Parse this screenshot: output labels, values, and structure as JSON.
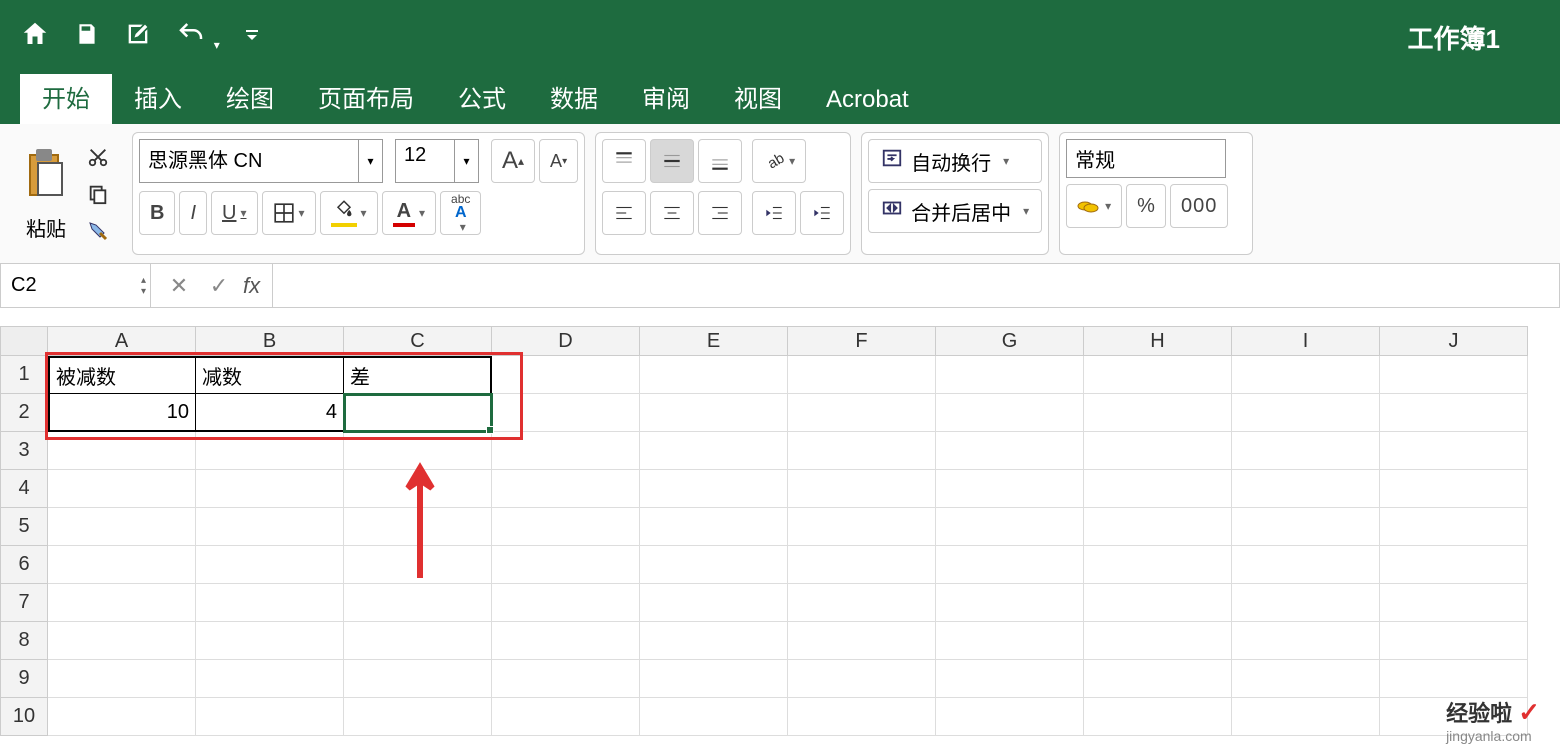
{
  "titlebar": {
    "doc_title": "工作簿1"
  },
  "tabs": {
    "home": "开始",
    "insert": "插入",
    "draw": "绘图",
    "layout": "页面布局",
    "formula": "公式",
    "data": "数据",
    "review": "审阅",
    "view": "视图",
    "acrobat": "Acrobat"
  },
  "ribbon": {
    "paste_label": "粘贴",
    "font_name": "思源黑体 CN",
    "font_size": "12",
    "wrap_text": "自动换行",
    "merge_center": "合并后居中",
    "number_format": "常规",
    "btn_bold": "B",
    "btn_italic": "I",
    "btn_underline": "U",
    "font_A_big": "A",
    "font_A_small": "A",
    "fill_icon": "◇",
    "font_color": "A",
    "phonetic": "abc",
    "phonetic_sub": "A",
    "thousand": "000",
    "percent": "%"
  },
  "formula_bar": {
    "name_box": "C2",
    "fx": "fx",
    "formula": ""
  },
  "columns": [
    "A",
    "B",
    "C",
    "D",
    "E",
    "F",
    "G",
    "H",
    "I",
    "J"
  ],
  "rows": [
    "1",
    "2",
    "3",
    "4",
    "5",
    "6",
    "7",
    "8",
    "9",
    "10"
  ],
  "cells": {
    "A1": "被减数",
    "B1": "减数",
    "C1": "差",
    "A2": "10",
    "B2": "4",
    "C2": ""
  },
  "watermark": {
    "text": "经验啦",
    "url": "jingyanla.com"
  }
}
